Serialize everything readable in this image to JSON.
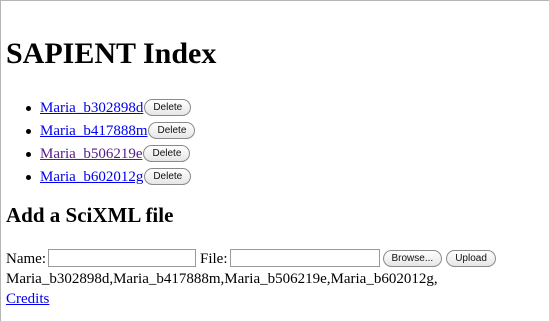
{
  "page": {
    "title": "SAPIENT Index"
  },
  "documents": [
    {
      "name": "Maria_b302898d",
      "delete_label": "Delete"
    },
    {
      "name": "Maria_b417888m",
      "delete_label": "Delete"
    },
    {
      "name": "Maria_b506219e",
      "delete_label": "Delete"
    },
    {
      "name": "Maria_b602012g",
      "delete_label": "Delete"
    }
  ],
  "upload_section": {
    "heading": "Add a SciXML file",
    "name_label": "Name:",
    "name_value": "",
    "file_label": "File:",
    "browse_label": "Browse...",
    "upload_label": "Upload"
  },
  "file_list_text": "Maria_b302898d,Maria_b417888m,Maria_b506219e,Maria_b602012g,",
  "credits_label": "Credits",
  "colors": {
    "link": "#0000ee",
    "visited_link": "#551a8b"
  }
}
